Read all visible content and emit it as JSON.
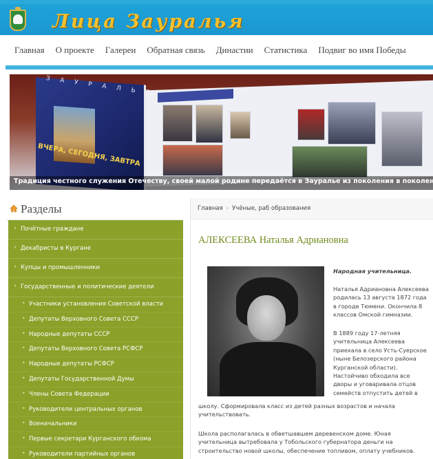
{
  "header": {
    "site_title": "Лица Зауралья"
  },
  "nav": {
    "items": [
      "Главная",
      "О проекте",
      "Галереи",
      "Обратная связь",
      "Династии",
      "Статистика",
      "Подвиг во имя Победы"
    ]
  },
  "banner": {
    "book_text": "З А У Р А Л Ь Е",
    "book_caption": "ВЧЕРА, СЕГОДНЯ, ЗАВТРА",
    "caption": "Традиция честного служения Отечеству, своей малой родине передаётся в Зауралье из поколения в поколение"
  },
  "sidebar": {
    "title": "Разделы",
    "top_items": [
      "Почётные граждане",
      "Декабристы в Кургане",
      "Купцы и промышленники",
      "Государственные и политические деятели"
    ],
    "sub_items": [
      "Участники установления Советской власти",
      "Депутаты Верховного Совета СССР",
      "Народные депутаты СССР",
      "Депутаты Верховного Совета РСФСР",
      "Народные депутаты РСФСР",
      "Депутаты Государственной Думы",
      "Члены Совета Федерации",
      "Руководители центральных органов",
      "Военачальники",
      "Первые секретари Курганского обкома",
      "Руководители партийных органов"
    ]
  },
  "main": {
    "breadcrumb_home": "Главная",
    "breadcrumb_current": "Учёные, раб образования",
    "title": "АЛЕКСЕЕВА Наталья Адриановна",
    "lead": "Народная учительница.",
    "para1": "Наталья Адриановна Алексеева родилась 13 августа 1872 года в городе Тюмени. Окончила 8 классов Омской гимназии.",
    "para2a": "В 1889 году 17-летняя учительница Алексеева приехала в село Усть-Суерское (ныне Белозерского района Курганской области). Настойчиво обходила все дворы и уговаривала отцов семейств отпустить детей в",
    "para2b": "школу. Сформировала класс из детей разных возрастов и начала учительствовать.",
    "para3": "Школа располагалась в обветшавшем деревенском доме. Юная учительница вытребовала у Тобольского губернатора деньги на строительство новой школы, обеспечение топливом, оплату учебников."
  }
}
